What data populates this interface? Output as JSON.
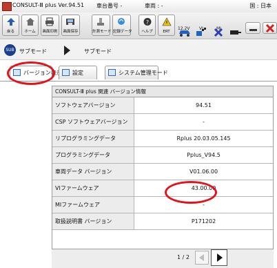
{
  "title_bar": {
    "app_title": "CONSULT-Ⅲ plus Ver.94.51",
    "vin_label": "車台番号 -",
    "vehicle_label": "車両 : -",
    "region_label": "国 : 日本"
  },
  "toolbar": {
    "buttons": [
      {
        "label": "戻る",
        "icon": "back-arrow-icon"
      },
      {
        "label": "ホーム",
        "icon": "home-icon"
      },
      {
        "label": "画面印刷",
        "icon": "print-icon"
      },
      {
        "label": "画面保存",
        "icon": "save-screen-icon"
      },
      {
        "label": "計測モード",
        "icon": "measure-icon"
      },
      {
        "label": "記録データ",
        "icon": "record-data-icon"
      },
      {
        "label": "ヘルプ",
        "icon": "help-icon"
      }
    ],
    "ert_label": "ERT",
    "voltage_label": "12.2V",
    "vi_label": "VI",
    "mi_label": "MI"
  },
  "breadcrumb": {
    "icon_text": "SUB",
    "first": "サブモード",
    "second": "サブモード"
  },
  "tabs": [
    {
      "label": "バージョン表示"
    },
    {
      "label": "設定"
    },
    {
      "label": "システム管理モード"
    }
  ],
  "panel": {
    "title": "CONSULT-Ⅲ plus 関連 バージョン情報",
    "rows": [
      {
        "label": "ソフトウェアバージョン",
        "value": "94.51"
      },
      {
        "label": "CSP ソフトウェアバージョン",
        "value": "-"
      },
      {
        "label": "リプログラミングデータ",
        "value": "Rplus 20.03.05.145"
      },
      {
        "label": "プログラミングデータ",
        "value": "Pplus_V94.5"
      },
      {
        "label": "車両データ バージョン",
        "value": "V01.06.00"
      },
      {
        "label": "VIファームウェア",
        "value": "43.00.00"
      },
      {
        "label": "MIファームウェア",
        "value": "-"
      },
      {
        "label": "取扱説明書 バージョン",
        "value": "P171202"
      }
    ]
  },
  "pager": {
    "page_indicator": "1 / 2"
  },
  "colors": {
    "annotation_red": "#e3121b",
    "sub_icon_blue": "#1a3f8f",
    "row_label_bg": "#ececec"
  }
}
